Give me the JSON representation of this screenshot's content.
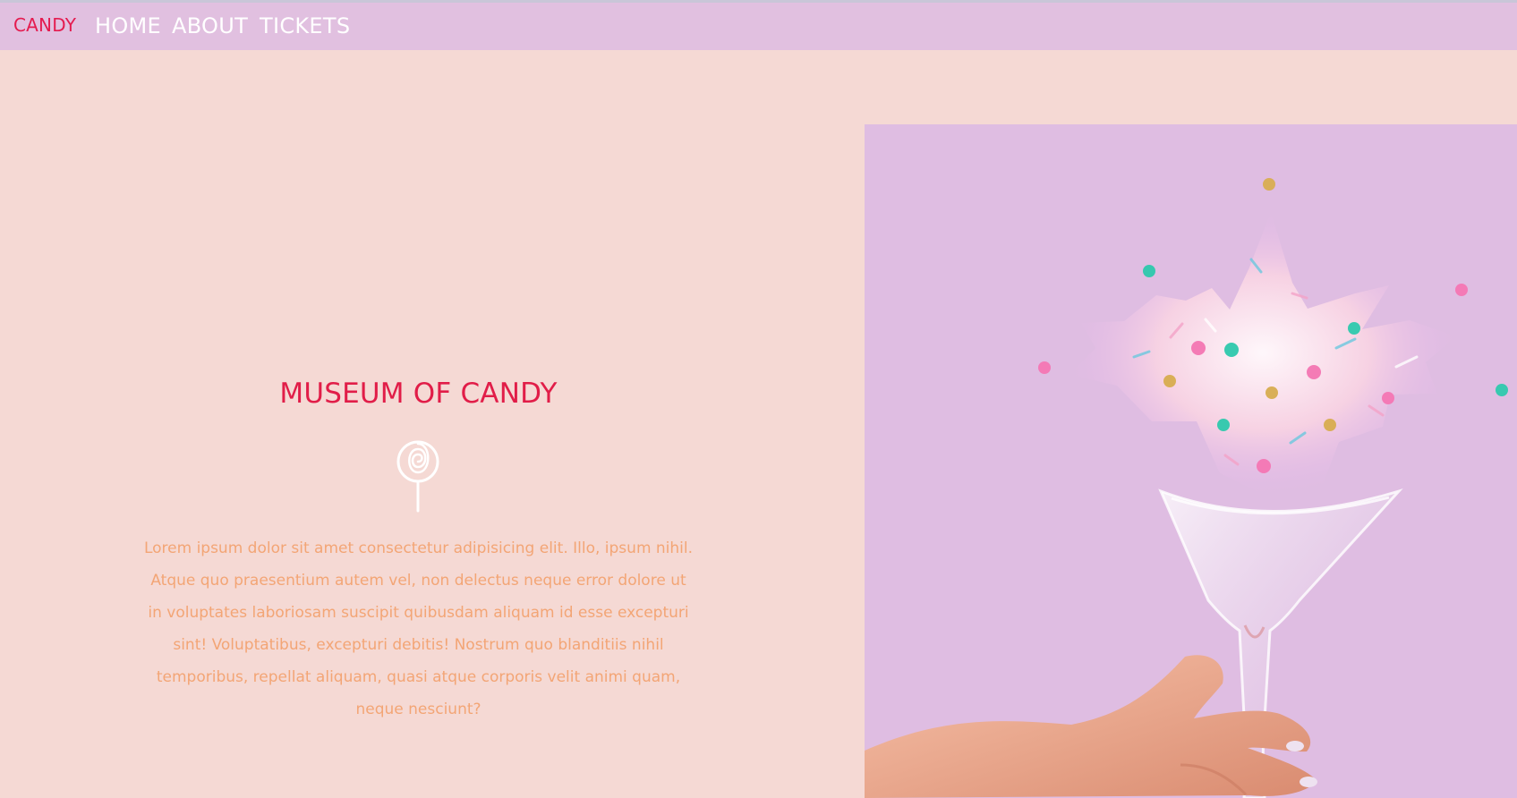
{
  "nav": {
    "brand": "CANDY",
    "links": [
      "HOME",
      "ABOUT",
      "TICKETS"
    ]
  },
  "hero": {
    "title": "MUSEUM OF CANDY",
    "icon": "lollipop-icon",
    "description": "Lorem ipsum dolor sit amet consectetur adipisicing elit. Illo, ipsum nihil. Atque quo praesentium autem vel, non delectus neque error dolore ut in voluptates laboriosam suscipit quibusdam aliquam id esse excepturi sint! Voluptatibus, excepturi debitis! Nostrum quo blanditiis nihil temporibus, repellat aliquam, quasi atque corporis velit animi quam, neque nesciunt?",
    "image": "martini-glass-sprinkles-photo"
  },
  "colors": {
    "nav_background": "#e1c0e0",
    "page_background": "#f5d9d4",
    "brand": "#e41b4f",
    "title": "#e11d48",
    "description": "#f3a575",
    "image_background": "#dfbde2",
    "nav_text": "#ffffff"
  }
}
